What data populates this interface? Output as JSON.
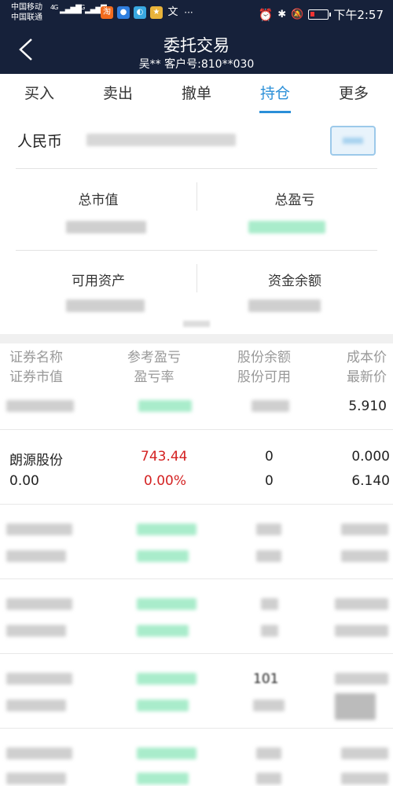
{
  "status_bar": {
    "carrier_1": "中国移动",
    "carrier_2": "中国联通",
    "network_1": "4G",
    "network_2": "3G",
    "time": "下午2:57",
    "more": "···"
  },
  "header": {
    "title": "委托交易",
    "subtitle": "吴**  客户号:810**030"
  },
  "tabs": [
    {
      "label": "买入"
    },
    {
      "label": "卖出"
    },
    {
      "label": "撤单"
    },
    {
      "label": "持仓"
    },
    {
      "label": "更多"
    }
  ],
  "account": {
    "label": "人民币"
  },
  "stats": {
    "total_market_value": "总市值",
    "total_profit": "总盈亏",
    "available_assets": "可用资产",
    "fund_balance": "资金余额"
  },
  "table": {
    "columns": [
      {
        "top": "证券名称",
        "bottom": "证券市值"
      },
      {
        "top": "参考盈亏",
        "bottom": "盈亏率"
      },
      {
        "top": "股份余额",
        "bottom": "股份可用"
      },
      {
        "top": "成本价",
        "bottom": "最新价"
      }
    ],
    "partial_row_cost": "5.910",
    "visible_row": {
      "name": "朗源股份",
      "market_value": "0.00",
      "profit": "743.44",
      "profit_rate": "0.00%",
      "balance": "0",
      "available": "0",
      "cost": "0.000",
      "latest": "6.140"
    },
    "row4_balance": "101"
  },
  "colors": {
    "header_bg": "#16213a",
    "accent": "#2a8fd8",
    "loss_red": "#d42222"
  }
}
